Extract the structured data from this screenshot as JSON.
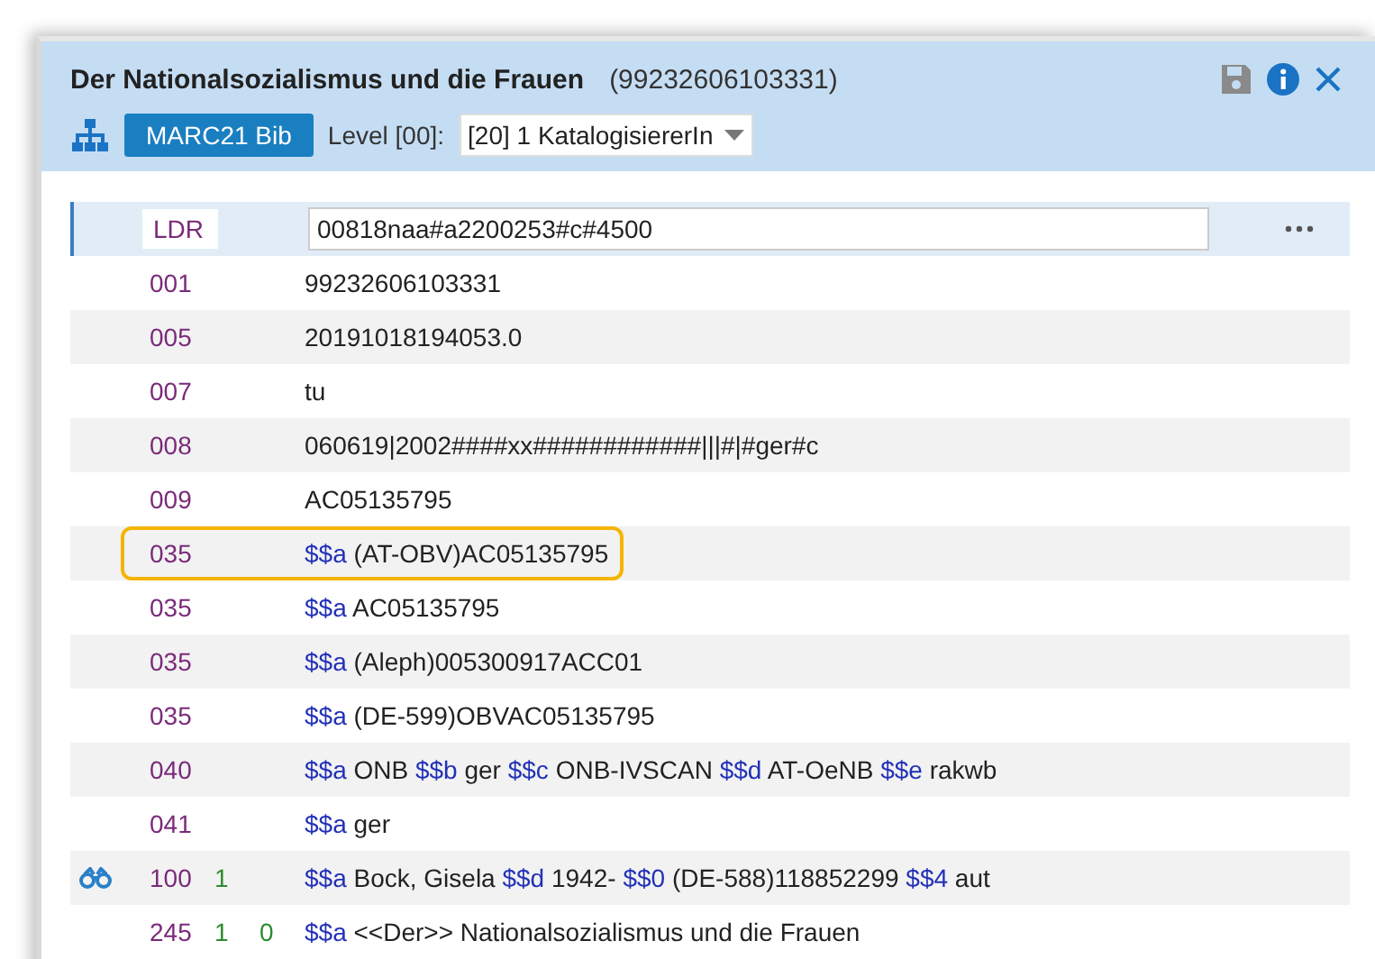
{
  "header": {
    "title": "Der Nationalsozialismus und die Frauen",
    "record_id": "(99232606103331)",
    "format": "MARC21 Bib",
    "level_label": "Level [00]:",
    "level_value": "[20] 1 KatalogisiererIn"
  },
  "rows": [
    {
      "kind": "leader",
      "tag": "LDR",
      "content": "00818naa#a2200253#c#4500",
      "selected": true,
      "highlighted": false,
      "lookup": false
    },
    {
      "kind": "control",
      "tag": "001",
      "content": "99232606103331",
      "selected": false,
      "highlighted": false,
      "lookup": false
    },
    {
      "kind": "control",
      "tag": "005",
      "content": "20191018194053.0",
      "selected": false,
      "highlighted": false,
      "lookup": false
    },
    {
      "kind": "control",
      "tag": "007",
      "content": "tu",
      "selected": false,
      "highlighted": false,
      "lookup": false
    },
    {
      "kind": "control",
      "tag": "008",
      "content": "060619|2002####xx############|||#|#ger#c",
      "selected": false,
      "highlighted": false,
      "lookup": false
    },
    {
      "kind": "control",
      "tag": "009",
      "content": "AC05135795",
      "selected": false,
      "highlighted": false,
      "lookup": false
    },
    {
      "kind": "data",
      "tag": "035",
      "subfields": [
        {
          "code": "$$a",
          "value": "(AT-OBV)AC05135795"
        }
      ],
      "selected": false,
      "highlighted": true,
      "lookup": false
    },
    {
      "kind": "data",
      "tag": "035",
      "subfields": [
        {
          "code": "$$a",
          "value": "AC05135795"
        }
      ],
      "selected": false,
      "highlighted": false,
      "lookup": false
    },
    {
      "kind": "data",
      "tag": "035",
      "subfields": [
        {
          "code": "$$a",
          "value": "(Aleph)005300917ACC01"
        }
      ],
      "selected": false,
      "highlighted": false,
      "lookup": false
    },
    {
      "kind": "data",
      "tag": "035",
      "subfields": [
        {
          "code": "$$a",
          "value": "(DE-599)OBVAC05135795"
        }
      ],
      "selected": false,
      "highlighted": false,
      "lookup": false
    },
    {
      "kind": "data",
      "tag": "040",
      "subfields": [
        {
          "code": "$$a",
          "value": "ONB"
        },
        {
          "code": "$$b",
          "value": "ger"
        },
        {
          "code": "$$c",
          "value": "ONB-IVSCAN"
        },
        {
          "code": "$$d",
          "value": "AT-OeNB"
        },
        {
          "code": "$$e",
          "value": "rakwb"
        }
      ],
      "selected": false,
      "highlighted": false,
      "lookup": false
    },
    {
      "kind": "data",
      "tag": "041",
      "subfields": [
        {
          "code": "$$a",
          "value": "ger"
        }
      ],
      "selected": false,
      "highlighted": false,
      "lookup": false
    },
    {
      "kind": "data",
      "tag": "100",
      "ind1": "1",
      "subfields": [
        {
          "code": "$$a",
          "value": "Bock, Gisela"
        },
        {
          "code": "$$d",
          "value": "1942-"
        },
        {
          "code": "$$0",
          "value": "(DE-588)118852299"
        },
        {
          "code": "$$4",
          "value": "aut"
        }
      ],
      "selected": false,
      "highlighted": false,
      "lookup": true
    },
    {
      "kind": "data",
      "tag": "245",
      "ind1": "1",
      "ind2": "0",
      "subfields": [
        {
          "code": "$$a",
          "value": "<<Der>> Nationalsozialismus und die Frauen"
        }
      ],
      "selected": false,
      "highlighted": false,
      "lookup": false
    }
  ]
}
